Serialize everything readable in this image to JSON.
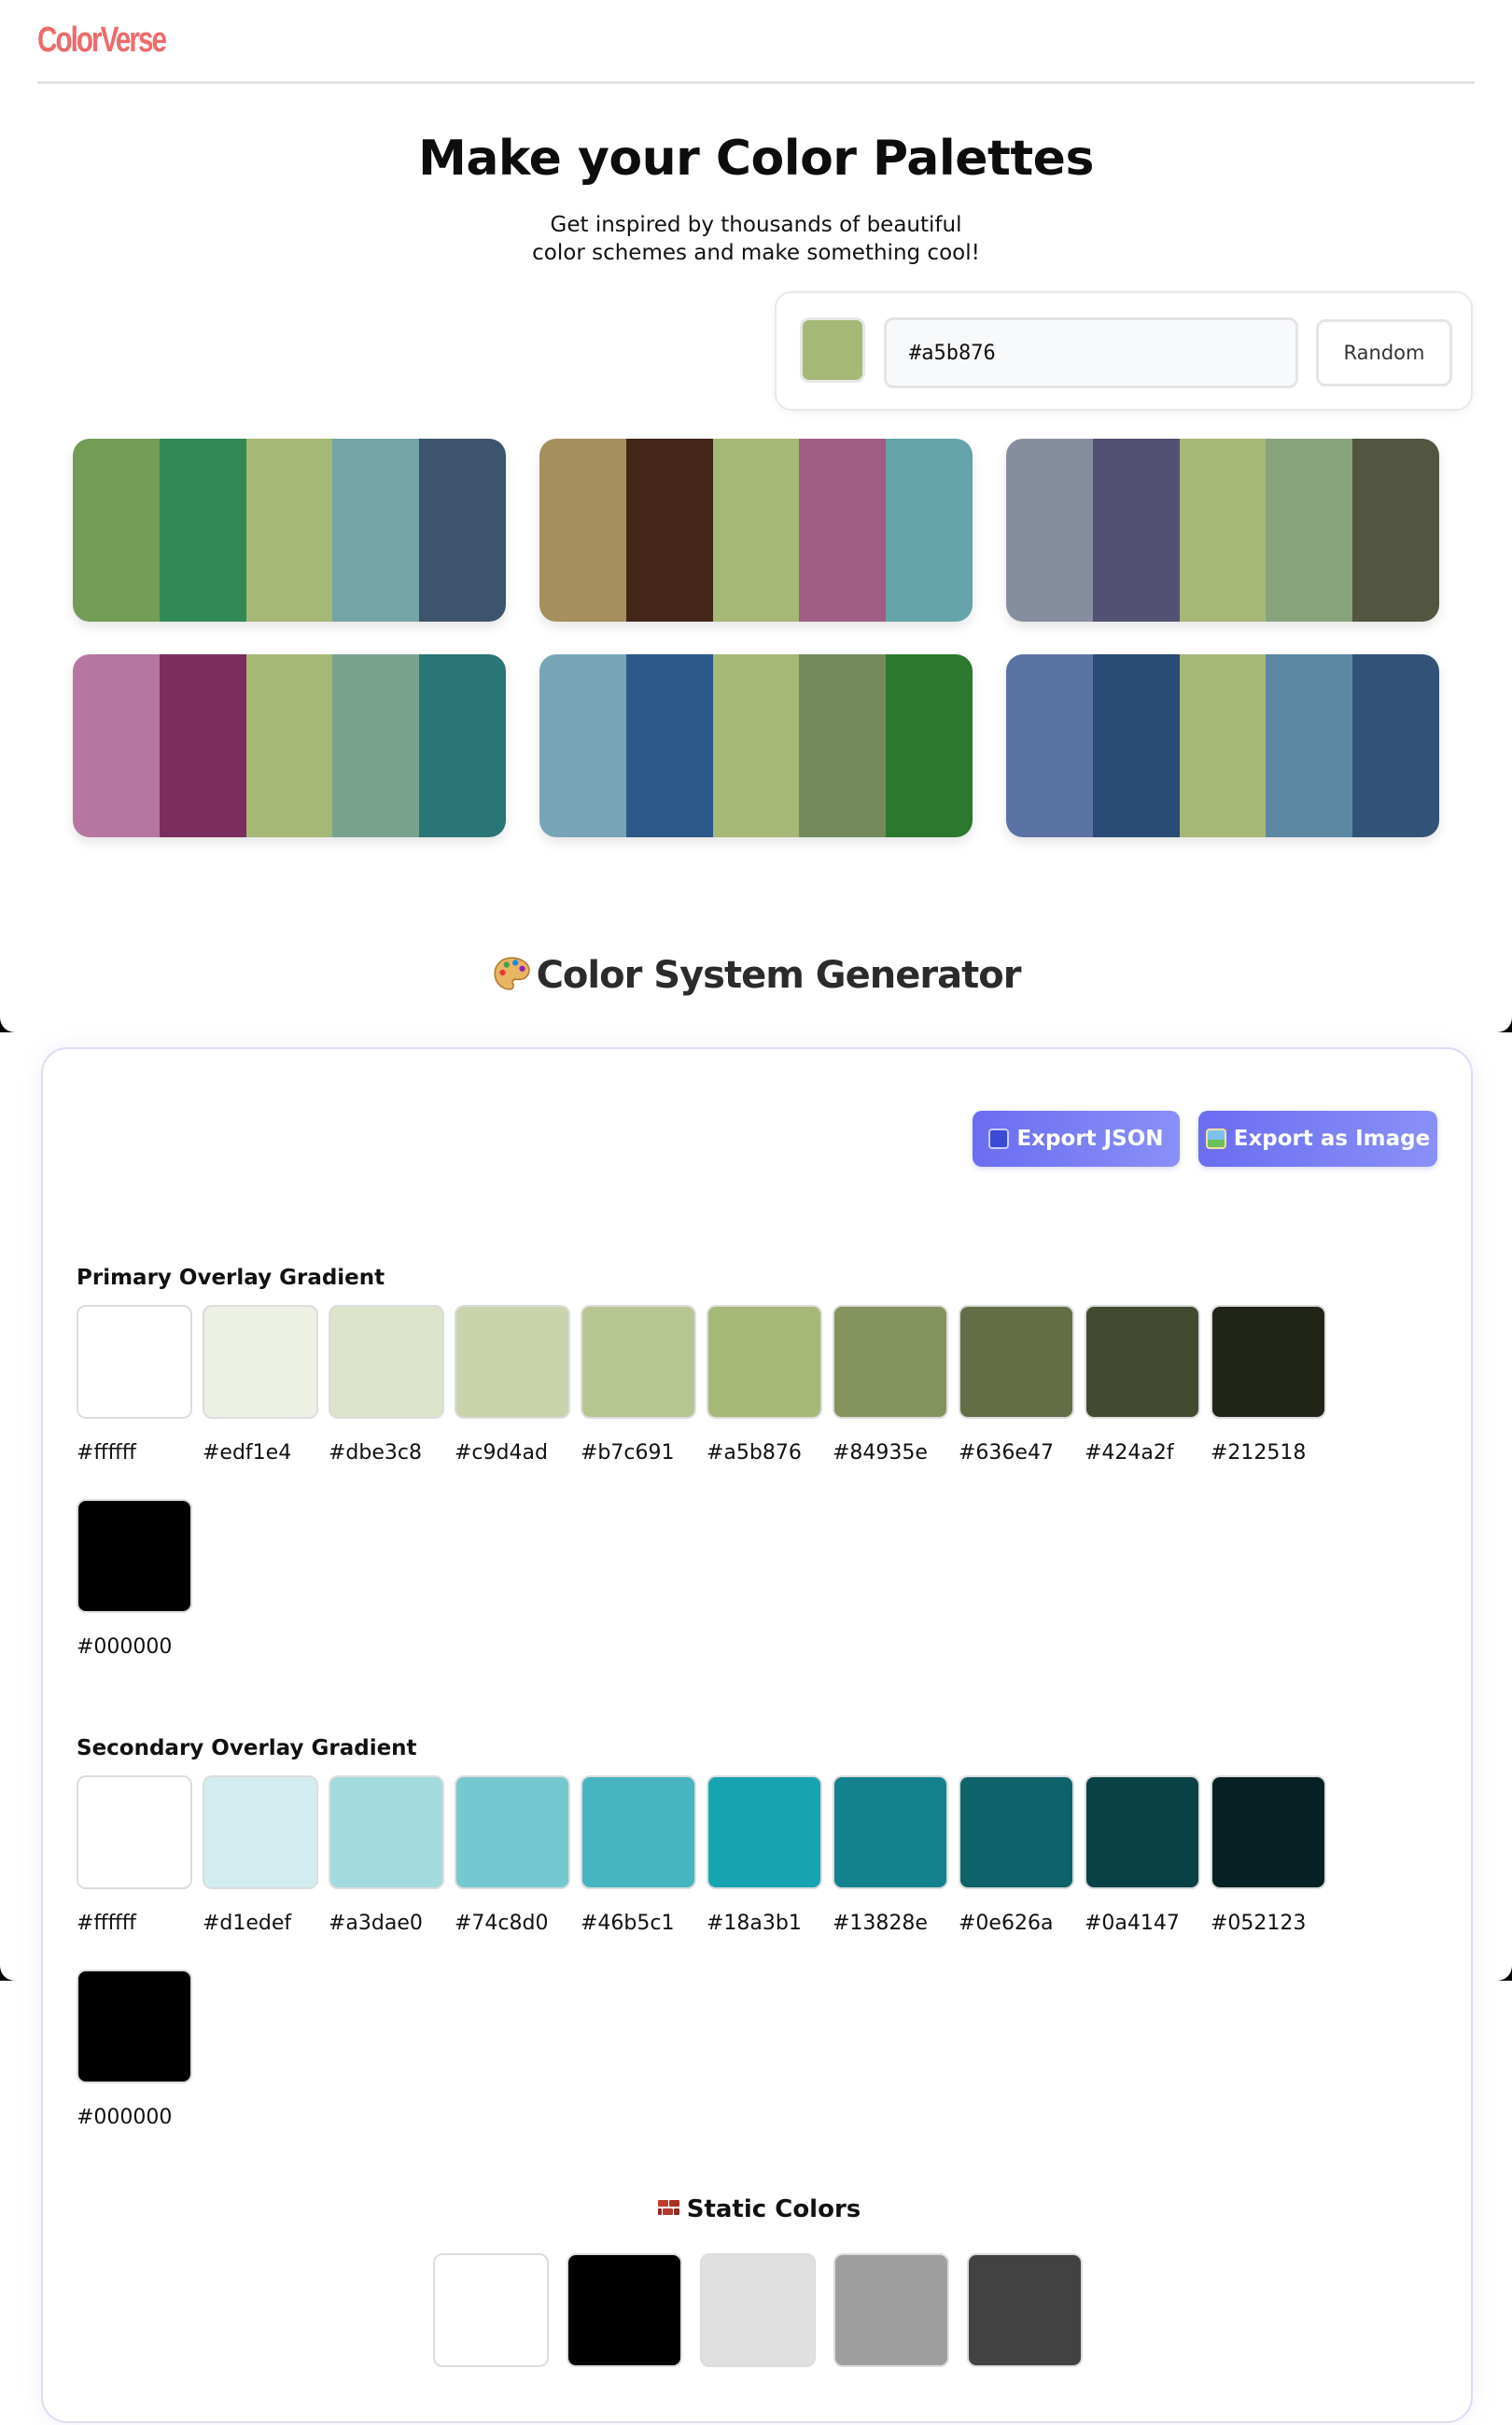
{
  "brand": {
    "logo": "ColorVerse",
    "accent": "#ee6a6a"
  },
  "hero": {
    "title": "Make your Color Palettes",
    "subtitle_line1": "Get inspired by thousands of beautiful",
    "subtitle_line2": "color schemes and make something cool!"
  },
  "picker": {
    "selected_color": "#a5b876",
    "hex_value": "#a5b876",
    "random_label": "Random"
  },
  "palettes": [
    [
      "#739c57",
      "#318a54",
      "#a5b876",
      "#74a4a6",
      "#3c556d"
    ],
    [
      "#a68f5f",
      "#442619",
      "#a5b876",
      "#9f5d84",
      "#66a3aa"
    ],
    [
      "#868d9f",
      "#525073",
      "#a5b876",
      "#86a37c",
      "#525540"
    ],
    [
      "#b776a1",
      "#7a2d5e",
      "#a5b876",
      "#79a38f",
      "#2a7575"
    ],
    [
      "#77a5b7",
      "#2c598a",
      "#a5b876",
      "#758a5c",
      "#2c782f"
    ],
    [
      "#5b72a5",
      "#294b75",
      "#a5b876",
      "#5d88a3",
      "#325277"
    ]
  ],
  "generator": {
    "title": "Color System Generator",
    "export_json_label": "Export JSON",
    "export_image_label": "Export as Image",
    "primary": {
      "title": "Primary Overlay Gradient",
      "colors": [
        "#ffffff",
        "#edf1e4",
        "#dbe3c8",
        "#c9d4ad",
        "#b7c691",
        "#a5b876",
        "#84935e",
        "#636e47",
        "#424a2f",
        "#212518",
        "#000000"
      ]
    },
    "secondary": {
      "title": "Secondary Overlay Gradient",
      "colors": [
        "#ffffff",
        "#d1edef",
        "#a3dae0",
        "#74c8d0",
        "#46b5c1",
        "#18a3b1",
        "#13828e",
        "#0e626a",
        "#0a4147",
        "#052123",
        "#000000"
      ]
    },
    "static": {
      "title": "Static Colors",
      "colors": [
        "#ffffff",
        "#000000",
        "#e0e0e0",
        "#9e9e9e",
        "#424242"
      ]
    }
  }
}
